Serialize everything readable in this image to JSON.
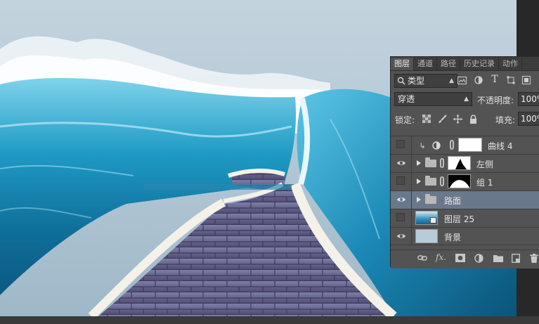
{
  "panel": {
    "tabs": [
      "图层",
      "通道",
      "路径",
      "历史记录",
      "动作"
    ],
    "active_tab": 0,
    "filter_kind": "类型",
    "filter_search_icon": "search-icon",
    "blend_mode": "穿透",
    "opacity_label": "不透明度:",
    "opacity_value": "100%",
    "lock_label": "锁定:",
    "fill_label": "填充:",
    "fill_value": "100%",
    "layers": [
      {
        "name": "曲线 4",
        "visible": false,
        "type": "adjustment"
      },
      {
        "name": "左侧",
        "visible": true,
        "type": "group"
      },
      {
        "name": "组 1",
        "visible": false,
        "type": "group"
      },
      {
        "name": "路面",
        "visible": true,
        "type": "group",
        "selected": true
      },
      {
        "name": "图层 25",
        "visible": false,
        "type": "smart"
      },
      {
        "name": "背景",
        "visible": true,
        "type": "background"
      }
    ],
    "footer_fx": "fx."
  },
  "colors": {
    "panel_bg": "#535353",
    "selected_row": "#6a788c",
    "canvas_sky": "#c3d3de",
    "wave_blue": "#1b8fb8",
    "road": "#5e5a7d"
  }
}
